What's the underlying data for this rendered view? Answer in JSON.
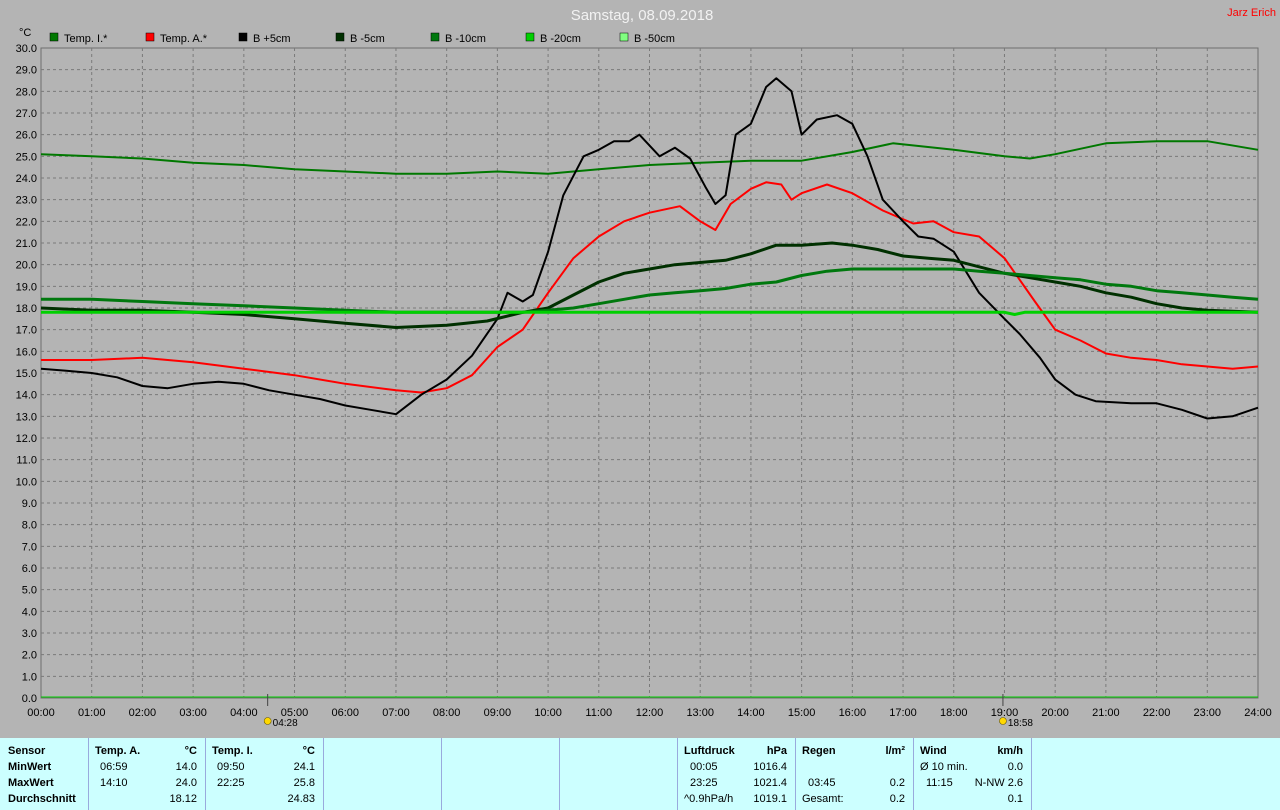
{
  "header": {
    "title": "Samstag, 08.09.2018",
    "author": "Jarz Erich"
  },
  "chart_data": {
    "type": "line",
    "ylabel": "°C",
    "ylim": [
      0,
      30
    ],
    "yticks": [
      "0.0",
      "1.0",
      "2.0",
      "3.0",
      "4.0",
      "5.0",
      "6.0",
      "7.0",
      "8.0",
      "9.0",
      "10.0",
      "11.0",
      "12.0",
      "13.0",
      "14.0",
      "15.0",
      "16.0",
      "17.0",
      "18.0",
      "19.0",
      "20.0",
      "21.0",
      "22.0",
      "23.0",
      "24.0",
      "25.0",
      "26.0",
      "27.0",
      "28.0",
      "29.0",
      "30.0"
    ],
    "xlim": [
      0,
      24
    ],
    "xticks": [
      "00:00",
      "01:00",
      "02:00",
      "03:00",
      "04:00",
      "05:00",
      "06:00",
      "07:00",
      "08:00",
      "09:00",
      "10:00",
      "11:00",
      "12:00",
      "13:00",
      "14:00",
      "15:00",
      "16:00",
      "17:00",
      "18:00",
      "19:00",
      "20:00",
      "21:00",
      "22:00",
      "23:00",
      "24:00"
    ],
    "grid": true,
    "legend_position": "top-left",
    "markers": [
      {
        "label": "04:28",
        "x": 4.47,
        "icon": "sunrise-icon"
      },
      {
        "label": "18:58",
        "x": 18.97,
        "icon": "sunset-icon"
      }
    ],
    "series": [
      {
        "name": "Temp. I.*",
        "color": "#007800",
        "width": 2,
        "points": [
          [
            0,
            25.1
          ],
          [
            1,
            25.0
          ],
          [
            2,
            24.9
          ],
          [
            3,
            24.7
          ],
          [
            4,
            24.6
          ],
          [
            5,
            24.4
          ],
          [
            6,
            24.3
          ],
          [
            7,
            24.2
          ],
          [
            8,
            24.2
          ],
          [
            9,
            24.3
          ],
          [
            10,
            24.2
          ],
          [
            11,
            24.4
          ],
          [
            12,
            24.6
          ],
          [
            13,
            24.7
          ],
          [
            14,
            24.8
          ],
          [
            15,
            24.8
          ],
          [
            16,
            25.2
          ],
          [
            16.8,
            25.6
          ],
          [
            18,
            25.3
          ],
          [
            19,
            25.0
          ],
          [
            19.5,
            24.9
          ],
          [
            20,
            25.1
          ],
          [
            21,
            25.6
          ],
          [
            22,
            25.7
          ],
          [
            23,
            25.7
          ],
          [
            24,
            25.3
          ]
        ]
      },
      {
        "name": "Temp. A.*",
        "color": "#ff0000",
        "width": 2,
        "points": [
          [
            0,
            15.6
          ],
          [
            1,
            15.6
          ],
          [
            2,
            15.7
          ],
          [
            3,
            15.5
          ],
          [
            4,
            15.2
          ],
          [
            5,
            14.9
          ],
          [
            6,
            14.5
          ],
          [
            7,
            14.2
          ],
          [
            7.5,
            14.1
          ],
          [
            8,
            14.3
          ],
          [
            8.5,
            14.9
          ],
          [
            9,
            16.2
          ],
          [
            9.5,
            17.0
          ],
          [
            10,
            18.7
          ],
          [
            10.5,
            20.3
          ],
          [
            11,
            21.3
          ],
          [
            11.5,
            22.0
          ],
          [
            12,
            22.4
          ],
          [
            12.6,
            22.7
          ],
          [
            13,
            22.0
          ],
          [
            13.3,
            21.6
          ],
          [
            13.6,
            22.8
          ],
          [
            14,
            23.5
          ],
          [
            14.3,
            23.8
          ],
          [
            14.6,
            23.7
          ],
          [
            14.8,
            23.0
          ],
          [
            15,
            23.3
          ],
          [
            15.5,
            23.7
          ],
          [
            16,
            23.3
          ],
          [
            16.6,
            22.5
          ],
          [
            17.2,
            21.9
          ],
          [
            17.6,
            22.0
          ],
          [
            18,
            21.5
          ],
          [
            18.5,
            21.3
          ],
          [
            19,
            20.3
          ],
          [
            19.3,
            19.3
          ],
          [
            19.6,
            18.3
          ],
          [
            20,
            17.0
          ],
          [
            20.5,
            16.5
          ],
          [
            21,
            15.9
          ],
          [
            21.5,
            15.7
          ],
          [
            22,
            15.6
          ],
          [
            22.5,
            15.4
          ],
          [
            23,
            15.3
          ],
          [
            23.5,
            15.2
          ],
          [
            24,
            15.3
          ]
        ]
      },
      {
        "name": "B +5cm",
        "color": "#000000",
        "width": 2,
        "points": [
          [
            0,
            15.2
          ],
          [
            0.5,
            15.1
          ],
          [
            1,
            15.0
          ],
          [
            1.5,
            14.8
          ],
          [
            2,
            14.4
          ],
          [
            2.5,
            14.3
          ],
          [
            3,
            14.5
          ],
          [
            3.5,
            14.6
          ],
          [
            4,
            14.5
          ],
          [
            4.5,
            14.2
          ],
          [
            5,
            14.0
          ],
          [
            5.5,
            13.8
          ],
          [
            6,
            13.5
          ],
          [
            6.5,
            13.3
          ],
          [
            7,
            13.1
          ],
          [
            7.5,
            14.0
          ],
          [
            8,
            14.7
          ],
          [
            8.5,
            15.8
          ],
          [
            9,
            17.5
          ],
          [
            9.2,
            18.7
          ],
          [
            9.5,
            18.3
          ],
          [
            9.7,
            18.6
          ],
          [
            10,
            20.6
          ],
          [
            10.3,
            23.2
          ],
          [
            10.7,
            25.0
          ],
          [
            11,
            25.3
          ],
          [
            11.3,
            25.7
          ],
          [
            11.6,
            25.7
          ],
          [
            11.8,
            26.0
          ],
          [
            12.2,
            25.0
          ],
          [
            12.5,
            25.4
          ],
          [
            12.8,
            24.9
          ],
          [
            13.1,
            23.6
          ],
          [
            13.3,
            22.8
          ],
          [
            13.5,
            23.2
          ],
          [
            13.7,
            26.0
          ],
          [
            14,
            26.5
          ],
          [
            14.3,
            28.2
          ],
          [
            14.5,
            28.6
          ],
          [
            14.8,
            28.0
          ],
          [
            15,
            26.0
          ],
          [
            15.3,
            26.7
          ],
          [
            15.7,
            26.9
          ],
          [
            16,
            26.5
          ],
          [
            16.3,
            25.0
          ],
          [
            16.6,
            23.0
          ],
          [
            17,
            22.0
          ],
          [
            17.3,
            21.3
          ],
          [
            17.6,
            21.2
          ],
          [
            18,
            20.6
          ],
          [
            18.5,
            18.7
          ],
          [
            19,
            17.5
          ],
          [
            19.3,
            16.8
          ],
          [
            19.7,
            15.7
          ],
          [
            20,
            14.7
          ],
          [
            20.4,
            14.0
          ],
          [
            20.8,
            13.7
          ],
          [
            21.5,
            13.6
          ],
          [
            22,
            13.6
          ],
          [
            22.5,
            13.3
          ],
          [
            23,
            12.9
          ],
          [
            23.5,
            13.0
          ],
          [
            24,
            13.4
          ]
        ]
      },
      {
        "name": "B -5cm",
        "color": "#003000",
        "width": 3,
        "points": [
          [
            0,
            18.0
          ],
          [
            1,
            17.9
          ],
          [
            2,
            17.9
          ],
          [
            3,
            17.8
          ],
          [
            4,
            17.7
          ],
          [
            5,
            17.5
          ],
          [
            6,
            17.3
          ],
          [
            7,
            17.1
          ],
          [
            8,
            17.2
          ],
          [
            8.8,
            17.4
          ],
          [
            9.5,
            17.8
          ],
          [
            10,
            18.0
          ],
          [
            10.5,
            18.6
          ],
          [
            11,
            19.2
          ],
          [
            11.5,
            19.6
          ],
          [
            12,
            19.8
          ],
          [
            12.5,
            20.0
          ],
          [
            13,
            20.1
          ],
          [
            13.5,
            20.2
          ],
          [
            14,
            20.5
          ],
          [
            14.5,
            20.9
          ],
          [
            15,
            20.9
          ],
          [
            15.6,
            21.0
          ],
          [
            16,
            20.9
          ],
          [
            16.5,
            20.7
          ],
          [
            17,
            20.4
          ],
          [
            17.5,
            20.3
          ],
          [
            18,
            20.2
          ],
          [
            18.5,
            19.9
          ],
          [
            19,
            19.6
          ],
          [
            19.5,
            19.4
          ],
          [
            20,
            19.2
          ],
          [
            20.5,
            19.0
          ],
          [
            21,
            18.7
          ],
          [
            21.5,
            18.5
          ],
          [
            22,
            18.2
          ],
          [
            22.5,
            18.0
          ],
          [
            23,
            17.9
          ],
          [
            24,
            17.8
          ]
        ]
      },
      {
        "name": "B -10cm",
        "color": "#00780e",
        "width": 3,
        "points": [
          [
            0,
            18.4
          ],
          [
            1,
            18.4
          ],
          [
            2,
            18.3
          ],
          [
            3,
            18.2
          ],
          [
            4,
            18.1
          ],
          [
            5,
            18.0
          ],
          [
            6,
            17.9
          ],
          [
            7,
            17.8
          ],
          [
            8,
            17.8
          ],
          [
            9,
            17.8
          ],
          [
            9.5,
            17.8
          ],
          [
            10,
            17.9
          ],
          [
            10.5,
            18.0
          ],
          [
            11,
            18.2
          ],
          [
            11.5,
            18.4
          ],
          [
            12,
            18.6
          ],
          [
            12.5,
            18.7
          ],
          [
            13,
            18.8
          ],
          [
            13.5,
            18.9
          ],
          [
            14,
            19.1
          ],
          [
            14.5,
            19.2
          ],
          [
            15,
            19.5
          ],
          [
            15.5,
            19.7
          ],
          [
            16,
            19.8
          ],
          [
            16.5,
            19.8
          ],
          [
            17,
            19.8
          ],
          [
            17.5,
            19.8
          ],
          [
            18,
            19.8
          ],
          [
            18.5,
            19.7
          ],
          [
            19,
            19.6
          ],
          [
            19.5,
            19.5
          ],
          [
            20,
            19.4
          ],
          [
            20.5,
            19.3
          ],
          [
            21,
            19.1
          ],
          [
            21.5,
            19.0
          ],
          [
            22,
            18.8
          ],
          [
            22.5,
            18.7
          ],
          [
            23,
            18.6
          ],
          [
            23.5,
            18.5
          ],
          [
            24,
            18.4
          ]
        ]
      },
      {
        "name": "B -20cm",
        "color": "#00d000",
        "width": 3,
        "points": [
          [
            0,
            17.8
          ],
          [
            4,
            17.8
          ],
          [
            8,
            17.8
          ],
          [
            12,
            17.8
          ],
          [
            16,
            17.8
          ],
          [
            19,
            17.8
          ],
          [
            19.2,
            17.7
          ],
          [
            19.4,
            17.8
          ],
          [
            24,
            17.8
          ]
        ]
      },
      {
        "name": "B -50cm",
        "color": "#80ff80",
        "width": 2,
        "points": []
      }
    ]
  },
  "stats": {
    "row_labels": [
      "Sensor",
      "MinWert",
      "MaxWert",
      "Durchschnitt"
    ],
    "temp_a": {
      "title": "Temp. A.",
      "unit": "°C",
      "min_time": "06:59",
      "min": "14.0",
      "max_time": "14:10",
      "max": "24.0",
      "avg": "18.12"
    },
    "temp_i": {
      "title": "Temp. I.",
      "unit": "°C",
      "min_time": "09:50",
      "min": "24.1",
      "max_time": "22:25",
      "max": "25.8",
      "avg": "24.83"
    },
    "pressure": {
      "title": "Luftdruck",
      "unit": "hPa",
      "min_time": "00:05",
      "min": "1016.4",
      "max_time": "23:25",
      "max": "1021.4",
      "trend": "^0.9hPa/h",
      "avg": "1019.1"
    },
    "rain": {
      "title": "Regen",
      "unit": "l/m²",
      "max_time": "03:45",
      "max": "0.2",
      "total_label": "Gesamt:",
      "total": "0.2"
    },
    "wind": {
      "title": "Wind",
      "unit": "km/h",
      "min_label": "Ø 10 min.",
      "min": "0.0",
      "max_time": "11:15",
      "max": "N-NW 2.6",
      "avg": "0.1"
    }
  }
}
